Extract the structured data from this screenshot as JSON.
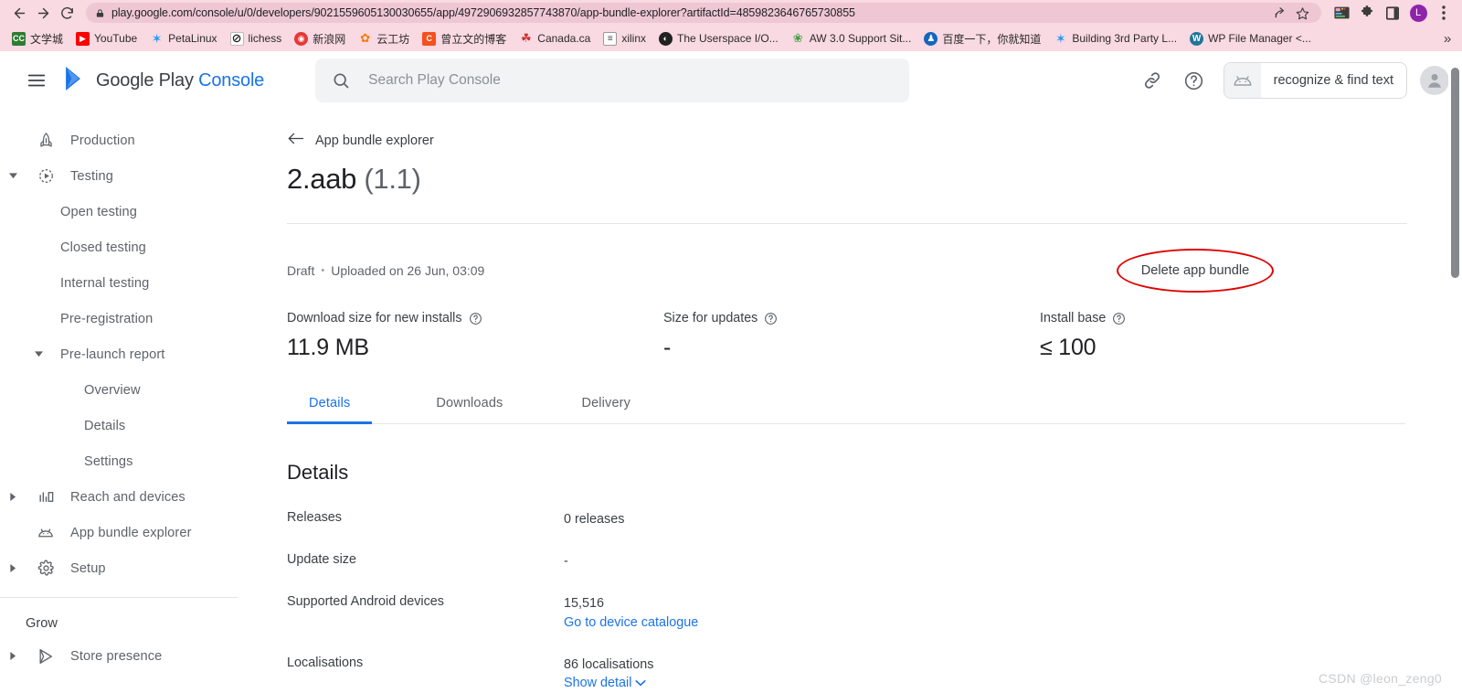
{
  "browser": {
    "url": "play.google.com/console/u/0/developers/9021559605130030655/app/4972906932857743870/app-bundle-explorer?artifactId=4859823646765730855",
    "nav": {
      "back": "back-arrow",
      "forward": "forward-arrow",
      "reload": "reload"
    },
    "omnibox_icons": [
      "share-icon",
      "bookmark-star-icon"
    ],
    "toolbar_icons": [
      "extension-card-icon",
      "puzzle-extensions-icon",
      "sidepanel-icon"
    ],
    "profile_initial": "L",
    "menu": "chrome-menu",
    "bookmarks": [
      {
        "label": "文学城",
        "favicon_text": "CC",
        "favicon_color": "#2e7d32"
      },
      {
        "label": "YouTube",
        "favicon_text": "▶",
        "favicon_color": "#ff0000"
      },
      {
        "label": "PetaLinux",
        "favicon_text": "✶",
        "favicon_color": "#2196f3"
      },
      {
        "label": "lichess",
        "favicon_text": "⊘",
        "favicon_color": "#ffffff"
      },
      {
        "label": "新浪网",
        "favicon_text": "◉",
        "favicon_color": "#e53935"
      },
      {
        "label": "云工坊",
        "favicon_text": "✿",
        "favicon_color": "#f57c00"
      },
      {
        "label": "曾立文的博客",
        "favicon_text": "C",
        "favicon_color": "#f4511e"
      },
      {
        "label": "Canada.ca",
        "favicon_text": "☘",
        "favicon_color": "#d32f2f"
      },
      {
        "label": "xilinx",
        "favicon_text": "≡",
        "favicon_color": "#616161"
      },
      {
        "label": "The Userspace I/O...",
        "favicon_text": "◐",
        "favicon_color": "#212121"
      },
      {
        "label": "AW 3.0 Support Sit...",
        "favicon_text": "❀",
        "favicon_color": "#43a047"
      },
      {
        "label": "百度一下，你就知道",
        "favicon_text": "♟",
        "favicon_color": "#1565c0"
      },
      {
        "label": "Building 3rd Party L...",
        "favicon_text": "✶",
        "favicon_color": "#2196f3"
      },
      {
        "label": "WP File Manager <...",
        "favicon_text": "W",
        "favicon_color": "#21759b"
      }
    ],
    "overflow": "»"
  },
  "appbar": {
    "menu_icon": "hamburger-menu-icon",
    "brand_google_play": "Google Play",
    "brand_console": "Console",
    "search_placeholder": "Search Play Console",
    "search_value": "",
    "link_icon": "link-icon",
    "help_icon": "help-circle-icon",
    "extension_label": "recognize & find text",
    "extension_icon": "android-head-icon",
    "account_icon": "account-avatar-icon"
  },
  "sidebar": {
    "items": [
      {
        "label": "Production",
        "level": 0,
        "icon": "rocket-icon",
        "arrow": ""
      },
      {
        "label": "Testing",
        "level": 0,
        "icon": "testing-play-icon",
        "arrow": "down"
      },
      {
        "label": "Open testing",
        "level": 1,
        "icon": "",
        "arrow": ""
      },
      {
        "label": "Closed testing",
        "level": 1,
        "icon": "",
        "arrow": ""
      },
      {
        "label": "Internal testing",
        "level": 1,
        "icon": "",
        "arrow": ""
      },
      {
        "label": "Pre-registration",
        "level": 1,
        "icon": "",
        "arrow": ""
      },
      {
        "label": "Pre-launch report",
        "level": "1b",
        "icon": "",
        "arrow": "down"
      },
      {
        "label": "Overview",
        "level": 2,
        "icon": "",
        "arrow": ""
      },
      {
        "label": "Details",
        "level": 2,
        "icon": "",
        "arrow": ""
      },
      {
        "label": "Settings",
        "level": 2,
        "icon": "",
        "arrow": ""
      },
      {
        "label": "Reach and devices",
        "level": 0,
        "icon": "bar-chart-icon",
        "arrow": "right"
      },
      {
        "label": "App bundle explorer",
        "level": 0,
        "icon": "android-bundle-icon",
        "arrow": ""
      },
      {
        "label": "Setup",
        "level": 0,
        "icon": "gear-icon",
        "arrow": "right"
      }
    ],
    "section_grow": "Grow",
    "grow_items": [
      {
        "label": "Store presence",
        "level": 0,
        "icon": "google-play-triangle-icon",
        "arrow": "right"
      }
    ]
  },
  "main": {
    "back_label": "App bundle explorer",
    "back_icon": "arrow-left-icon",
    "title_name": "2.aab",
    "title_version": "(1.1)",
    "status": "Draft",
    "separator": "•",
    "uploaded": "Uploaded on 26 Jun, 03:09",
    "delete_button": "Delete app bundle",
    "annotation_color": "#e00000",
    "stats": [
      {
        "label": "Download size for new installs",
        "value": "11.9 MB",
        "help": "help-circle-icon"
      },
      {
        "label": "Size for updates",
        "value": "-",
        "help": "help-circle-icon"
      },
      {
        "label": "Install base",
        "value": "≤ 100",
        "help": "help-circle-icon"
      }
    ],
    "tabs": [
      {
        "label": "Details",
        "active": true
      },
      {
        "label": "Downloads",
        "active": false
      },
      {
        "label": "Delivery",
        "active": false
      }
    ],
    "details_heading": "Details",
    "details_rows": [
      {
        "label": "Releases",
        "value": "0 releases",
        "link": "",
        "link_icon": ""
      },
      {
        "label": "Update size",
        "value": "-",
        "link": "",
        "link_icon": ""
      },
      {
        "label": "Supported Android devices",
        "value": "15,516",
        "link": "Go to device catalogue",
        "link_icon": ""
      },
      {
        "label": "Localisations",
        "value": "86 localisations",
        "link": "Show detail",
        "link_icon": "chevron-down-icon"
      }
    ]
  },
  "watermark": "CSDN @leon_zeng0"
}
